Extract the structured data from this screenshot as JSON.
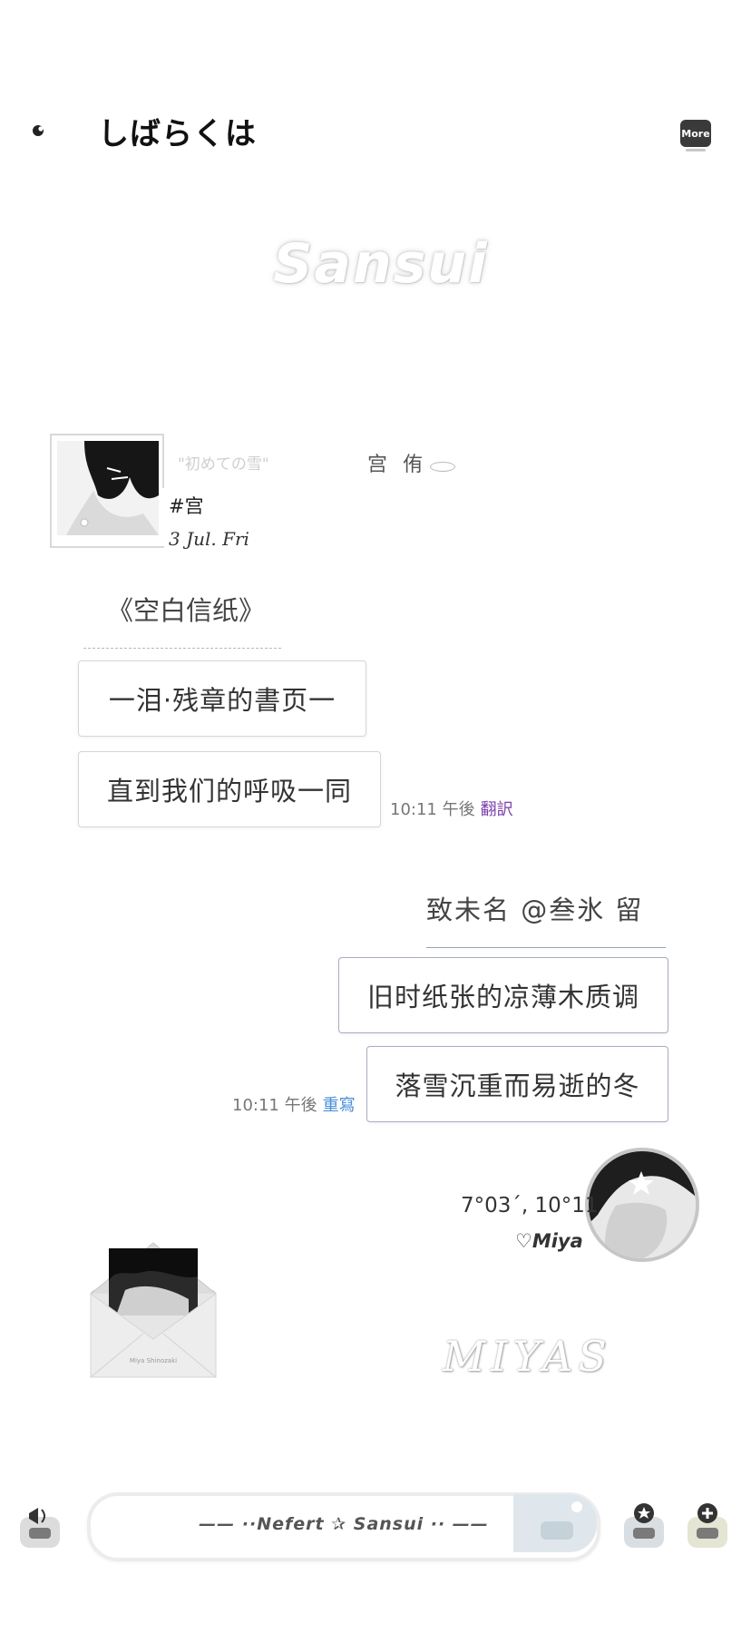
{
  "header": {
    "title": "しばらくは",
    "more_label": "More"
  },
  "watermark": "Sansui",
  "profile": {
    "deco_text": "\"初めての雪\"",
    "name": "宫 侑",
    "tag": "#宫",
    "date": "3 Jul. Fri"
  },
  "left_message": {
    "heading": "《空白信纸》",
    "bubbles": [
      "一泪·残章的書页一",
      "直到我们的呼吸一同"
    ],
    "time": "10:11 午後",
    "action": "翻訳"
  },
  "right_message": {
    "heading": "致未名 @叁氷 留",
    "bubbles": [
      "旧时纸张的凉薄木质调",
      "落雪沉重而易逝的冬"
    ],
    "time": "10:11 午後",
    "action": "重寫"
  },
  "right_profile": {
    "time": "7°03´, 10°11",
    "signature": "♡Miya"
  },
  "envelope_text": "Miya Shinozaki",
  "signature_deco": "MIYAS",
  "bottom_bar": {
    "input_text": "—— ··Nefert ✰ Sansui ·· ——"
  },
  "colors": {
    "translate_action": "#7a3fa8",
    "rewrite_action": "#4a8fd8",
    "right_bubble_border": "#a7adc0"
  }
}
